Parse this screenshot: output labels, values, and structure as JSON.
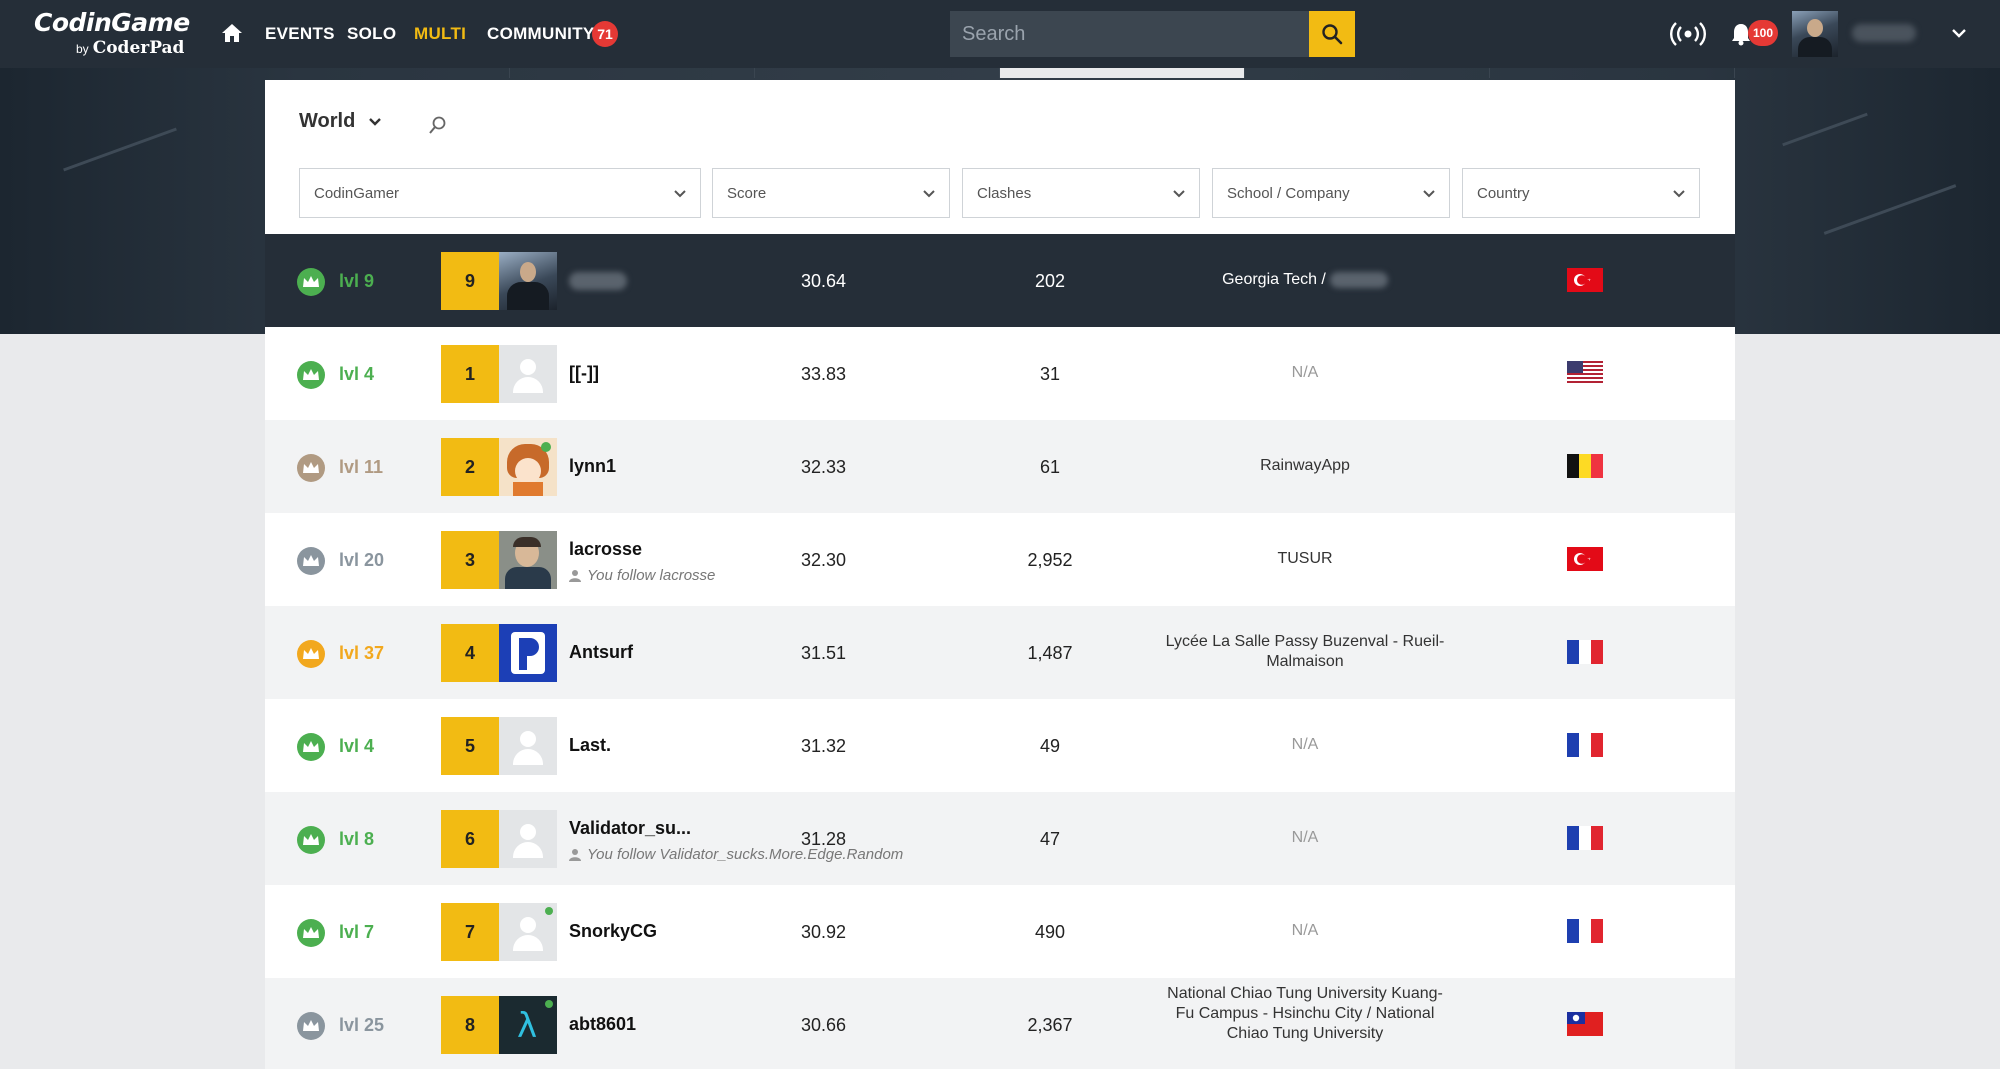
{
  "nav": {
    "logo_main": "CodinGame",
    "logo_by": "by",
    "logo_sub": "CoderPad",
    "items": [
      {
        "label": "EVENTS",
        "active": false
      },
      {
        "label": "SOLO",
        "active": false
      },
      {
        "label": "MULTI",
        "active": true
      },
      {
        "label": "COMMUNITY",
        "active": false
      }
    ],
    "community_badge": "71",
    "search_placeholder": "Search",
    "notification_count": "100"
  },
  "leaderboard": {
    "scope": "World",
    "filters": [
      "CodinGamer",
      "Score",
      "Clashes",
      "School / Company",
      "Country"
    ],
    "rows": [
      {
        "level": "lvl 9",
        "crown_color": "#4caf50",
        "rank": "9",
        "name": "",
        "score": "30.64",
        "clashes": "202",
        "school": "Georgia Tech /",
        "flag": "turkey",
        "me": true
      },
      {
        "level": "lvl 4",
        "crown_color": "#4caf50",
        "rank": "1",
        "name": "[[-]]",
        "score": "33.83",
        "clashes": "31",
        "school": "N/A",
        "flag": "usa"
      },
      {
        "level": "lvl 11",
        "crown_color": "#b09a82",
        "rank": "2",
        "name": "lynn1",
        "score": "32.33",
        "clashes": "61",
        "school": "RainwayApp",
        "flag": "belgium"
      },
      {
        "level": "lvl 20",
        "crown_color": "#8a959e",
        "rank": "3",
        "name": "lacrosse",
        "follow": "You follow lacrosse",
        "score": "32.30",
        "clashes": "2,952",
        "school": "TUSUR",
        "flag": "turkey"
      },
      {
        "level": "lvl 37",
        "crown_color": "#f2a81e",
        "rank": "4",
        "name": "Antsurf",
        "score": "31.51",
        "clashes": "1,487",
        "school": "Lycée La Salle Passy Buzenval - Rueil-Malmaison",
        "flag": "france"
      },
      {
        "level": "lvl 4",
        "crown_color": "#4caf50",
        "rank": "5",
        "name": "Last.",
        "score": "31.32",
        "clashes": "49",
        "school": "N/A",
        "flag": "france"
      },
      {
        "level": "lvl 8",
        "crown_color": "#4caf50",
        "rank": "6",
        "name": "Validator_su...",
        "follow": "You follow Validator_sucks.More.Edge.Random",
        "score": "31.28",
        "clashes": "47",
        "school": "N/A",
        "flag": "france"
      },
      {
        "level": "lvl 7",
        "crown_color": "#4caf50",
        "rank": "7",
        "name": "SnorkyCG",
        "score": "30.92",
        "clashes": "490",
        "school": "N/A",
        "flag": "france"
      },
      {
        "level": "lvl 25",
        "crown_color": "#8a959e",
        "rank": "8",
        "name": "abt8601",
        "score": "30.66",
        "clashes": "2,367",
        "school": "National Chiao Tung University Kuang-Fu Campus - Hsinchu City / National Chiao Tung University",
        "flag": "taiwan"
      }
    ]
  }
}
